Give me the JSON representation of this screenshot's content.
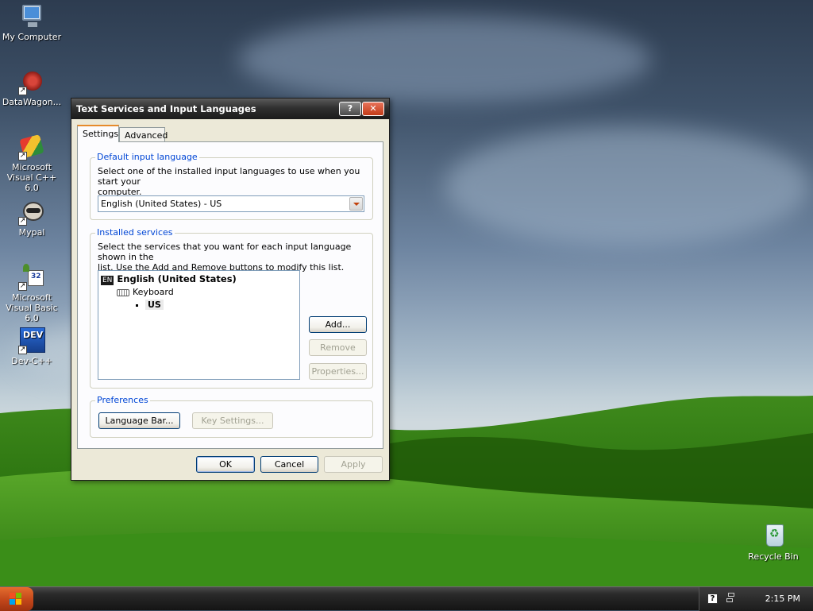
{
  "desktop": {
    "icons": [
      {
        "label": "My Computer",
        "icon": "computer-icon"
      },
      {
        "label": "DataWagon...",
        "icon": "datawagon-icon"
      },
      {
        "label": "Microsoft Visual C++ 6.0",
        "icon": "vc6-icon"
      },
      {
        "label": "Mypal",
        "icon": "mypal-icon"
      },
      {
        "label": "Microsoft Visual Basic 6.0",
        "icon": "vb6-icon"
      },
      {
        "label": "Dev-C++",
        "icon": "devcpp-icon"
      },
      {
        "label": "Recycle Bin",
        "icon": "recycle-bin-icon"
      }
    ],
    "devcpp_badge": "DEV",
    "vb_badge": "32"
  },
  "dialog": {
    "title": "Text Services and Input Languages",
    "help_glyph": "?",
    "close_glyph": "✕",
    "tabs": [
      "Settings",
      "Advanced"
    ],
    "default_input": {
      "legend": "Default input language",
      "desc_line1": "Select one of the installed input languages to use when you start your",
      "desc_line2": "computer.",
      "selected": "English (United States) - US"
    },
    "installed": {
      "legend": "Installed services",
      "desc_line1": "Select the services that you want for each input language shown in the",
      "desc_line2": "list. Use the Add and Remove buttons to modify this list.",
      "tree": {
        "lang_badge": "EN",
        "language": "English (United States)",
        "category": "Keyboard",
        "layout": "US"
      },
      "add": "Add...",
      "remove": "Remove",
      "properties": "Properties..."
    },
    "preferences": {
      "legend": "Preferences",
      "language_bar": "Language Bar...",
      "key_settings": "Key Settings..."
    },
    "ok": "OK",
    "cancel": "Cancel",
    "apply": "Apply"
  },
  "taskbar": {
    "clock": "2:15 PM"
  }
}
